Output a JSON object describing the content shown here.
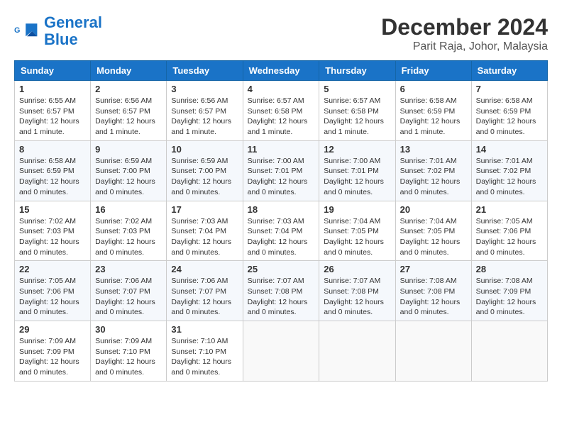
{
  "header": {
    "logo_line1": "General",
    "logo_line2": "Blue",
    "title": "December 2024",
    "subtitle": "Parit Raja, Johor, Malaysia"
  },
  "calendar": {
    "columns": [
      "Sunday",
      "Monday",
      "Tuesday",
      "Wednesday",
      "Thursday",
      "Friday",
      "Saturday"
    ],
    "weeks": [
      [
        {
          "day": 1,
          "rise": "6:55 AM",
          "set": "6:57 PM",
          "daylight": "12 hours and 1 minute."
        },
        {
          "day": 2,
          "rise": "6:56 AM",
          "set": "6:57 PM",
          "daylight": "12 hours and 1 minute."
        },
        {
          "day": 3,
          "rise": "6:56 AM",
          "set": "6:57 PM",
          "daylight": "12 hours and 1 minute."
        },
        {
          "day": 4,
          "rise": "6:57 AM",
          "set": "6:58 PM",
          "daylight": "12 hours and 1 minute."
        },
        {
          "day": 5,
          "rise": "6:57 AM",
          "set": "6:58 PM",
          "daylight": "12 hours and 1 minute."
        },
        {
          "day": 6,
          "rise": "6:58 AM",
          "set": "6:59 PM",
          "daylight": "12 hours and 1 minute."
        },
        {
          "day": 7,
          "rise": "6:58 AM",
          "set": "6:59 PM",
          "daylight": "12 hours and 0 minutes."
        }
      ],
      [
        {
          "day": 8,
          "rise": "6:58 AM",
          "set": "6:59 PM",
          "daylight": "12 hours and 0 minutes."
        },
        {
          "day": 9,
          "rise": "6:59 AM",
          "set": "7:00 PM",
          "daylight": "12 hours and 0 minutes."
        },
        {
          "day": 10,
          "rise": "6:59 AM",
          "set": "7:00 PM",
          "daylight": "12 hours and 0 minutes."
        },
        {
          "day": 11,
          "rise": "7:00 AM",
          "set": "7:01 PM",
          "daylight": "12 hours and 0 minutes."
        },
        {
          "day": 12,
          "rise": "7:00 AM",
          "set": "7:01 PM",
          "daylight": "12 hours and 0 minutes."
        },
        {
          "day": 13,
          "rise": "7:01 AM",
          "set": "7:02 PM",
          "daylight": "12 hours and 0 minutes."
        },
        {
          "day": 14,
          "rise": "7:01 AM",
          "set": "7:02 PM",
          "daylight": "12 hours and 0 minutes."
        }
      ],
      [
        {
          "day": 15,
          "rise": "7:02 AM",
          "set": "7:03 PM",
          "daylight": "12 hours and 0 minutes."
        },
        {
          "day": 16,
          "rise": "7:02 AM",
          "set": "7:03 PM",
          "daylight": "12 hours and 0 minutes."
        },
        {
          "day": 17,
          "rise": "7:03 AM",
          "set": "7:04 PM",
          "daylight": "12 hours and 0 minutes."
        },
        {
          "day": 18,
          "rise": "7:03 AM",
          "set": "7:04 PM",
          "daylight": "12 hours and 0 minutes."
        },
        {
          "day": 19,
          "rise": "7:04 AM",
          "set": "7:05 PM",
          "daylight": "12 hours and 0 minutes."
        },
        {
          "day": 20,
          "rise": "7:04 AM",
          "set": "7:05 PM",
          "daylight": "12 hours and 0 minutes."
        },
        {
          "day": 21,
          "rise": "7:05 AM",
          "set": "7:06 PM",
          "daylight": "12 hours and 0 minutes."
        }
      ],
      [
        {
          "day": 22,
          "rise": "7:05 AM",
          "set": "7:06 PM",
          "daylight": "12 hours and 0 minutes."
        },
        {
          "day": 23,
          "rise": "7:06 AM",
          "set": "7:07 PM",
          "daylight": "12 hours and 0 minutes."
        },
        {
          "day": 24,
          "rise": "7:06 AM",
          "set": "7:07 PM",
          "daylight": "12 hours and 0 minutes."
        },
        {
          "day": 25,
          "rise": "7:07 AM",
          "set": "7:08 PM",
          "daylight": "12 hours and 0 minutes."
        },
        {
          "day": 26,
          "rise": "7:07 AM",
          "set": "7:08 PM",
          "daylight": "12 hours and 0 minutes."
        },
        {
          "day": 27,
          "rise": "7:08 AM",
          "set": "7:08 PM",
          "daylight": "12 hours and 0 minutes."
        },
        {
          "day": 28,
          "rise": "7:08 AM",
          "set": "7:09 PM",
          "daylight": "12 hours and 0 minutes."
        }
      ],
      [
        {
          "day": 29,
          "rise": "7:09 AM",
          "set": "7:09 PM",
          "daylight": "12 hours and 0 minutes."
        },
        {
          "day": 30,
          "rise": "7:09 AM",
          "set": "7:10 PM",
          "daylight": "12 hours and 0 minutes."
        },
        {
          "day": 31,
          "rise": "7:10 AM",
          "set": "7:10 PM",
          "daylight": "12 hours and 0 minutes."
        },
        null,
        null,
        null,
        null
      ]
    ]
  }
}
